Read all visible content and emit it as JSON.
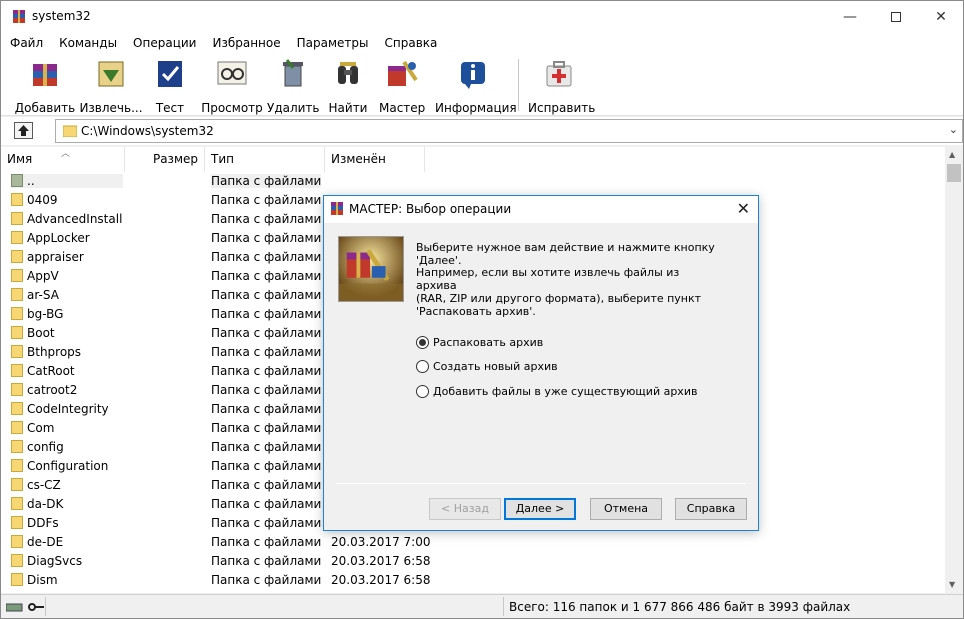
{
  "window": {
    "title": "system32"
  },
  "menu": [
    "Файл",
    "Команды",
    "Операции",
    "Избранное",
    "Параметры",
    "Справка"
  ],
  "toolbar": [
    {
      "label": "Добавить",
      "icon": "add-archive-icon"
    },
    {
      "label": "Извлечь...",
      "icon": "extract-icon"
    },
    {
      "label": "Тест",
      "icon": "test-icon"
    },
    {
      "label": "Просмотр",
      "icon": "view-icon"
    },
    {
      "label": "Удалить",
      "icon": "delete-icon"
    },
    {
      "label": "Найти",
      "icon": "find-icon"
    },
    {
      "label": "Мастер",
      "icon": "wizard-icon"
    },
    {
      "label": "Информация",
      "icon": "info-icon"
    },
    {
      "label": "Исправить",
      "icon": "repair-icon"
    }
  ],
  "address": {
    "path": "C:\\Windows\\system32"
  },
  "columns": {
    "name": "Имя",
    "size": "Размер",
    "type": "Тип",
    "modified": "Изменён"
  },
  "files": [
    {
      "name": "..",
      "type": "Папка с файлами",
      "modified": ""
    },
    {
      "name": "0409",
      "type": "Папка с файлами",
      "modified": ""
    },
    {
      "name": "AdvancedInstall...",
      "type": "Папка с файлами",
      "modified": ""
    },
    {
      "name": "AppLocker",
      "type": "Папка с файлами",
      "modified": ""
    },
    {
      "name": "appraiser",
      "type": "Папка с файлами",
      "modified": ""
    },
    {
      "name": "AppV",
      "type": "Папка с файлами",
      "modified": ""
    },
    {
      "name": "ar-SA",
      "type": "Папка с файлами",
      "modified": ""
    },
    {
      "name": "bg-BG",
      "type": "Папка с файлами",
      "modified": ""
    },
    {
      "name": "Boot",
      "type": "Папка с файлами",
      "modified": ""
    },
    {
      "name": "Bthprops",
      "type": "Папка с файлами",
      "modified": ""
    },
    {
      "name": "CatRoot",
      "type": "Папка с файлами",
      "modified": ""
    },
    {
      "name": "catroot2",
      "type": "Папка с файлами",
      "modified": ""
    },
    {
      "name": "CodeIntegrity",
      "type": "Папка с файлами",
      "modified": ""
    },
    {
      "name": "Com",
      "type": "Папка с файлами",
      "modified": ""
    },
    {
      "name": "config",
      "type": "Папка с файлами",
      "modified": ""
    },
    {
      "name": "Configuration",
      "type": "Папка с файлами",
      "modified": ""
    },
    {
      "name": "cs-CZ",
      "type": "Папка с файлами",
      "modified": ""
    },
    {
      "name": "da-DK",
      "type": "Папка с файлами",
      "modified": ""
    },
    {
      "name": "DDFs",
      "type": "Папка с файлами",
      "modified": ""
    },
    {
      "name": "de-DE",
      "type": "Папка с файлами",
      "modified": "20.03.2017 7:00"
    },
    {
      "name": "DiagSvcs",
      "type": "Папка с файлами",
      "modified": "20.03.2017 6:58"
    },
    {
      "name": "Dism",
      "type": "Папка с файлами",
      "modified": "20.03.2017 6:58"
    }
  ],
  "status": {
    "text": "Всего: 116 папок и 1 677 866 486 байт в 3993 файлах"
  },
  "dialog": {
    "title": "МАСТЕР:  Выбор операции",
    "message1": "Выберите нужное вам действие и нажмите кнопку 'Далее'.",
    "message2": "Например, если вы хотите извлечь файлы из архива\n(RAR, ZIP или другого формата), выберите пункт\n'Распаковать архив'.",
    "options": [
      {
        "label": "Распаковать архив",
        "selected": true
      },
      {
        "label": "Создать новый архив",
        "selected": false
      },
      {
        "label": "Добавить файлы в уже существующий архив",
        "selected": false
      }
    ],
    "buttons": {
      "back": "< Назад",
      "next": "Далее >",
      "cancel": "Отмена",
      "help": "Справка"
    }
  }
}
